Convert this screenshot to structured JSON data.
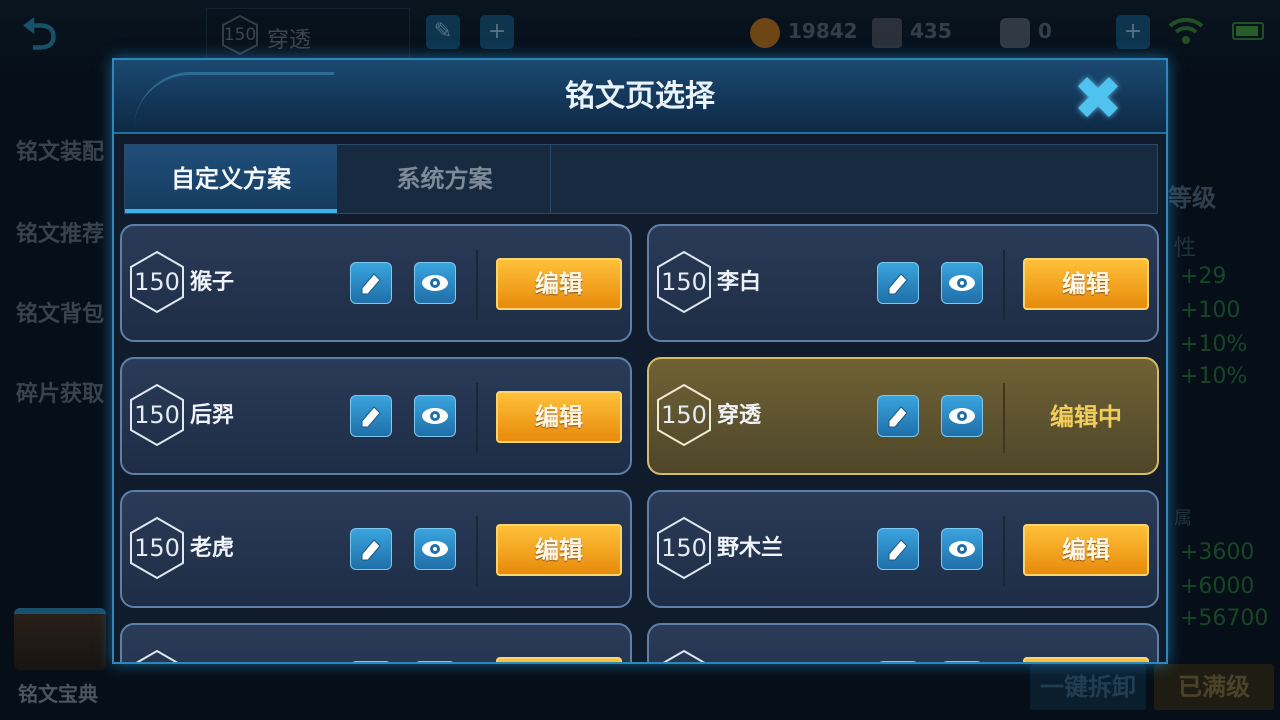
{
  "background": {
    "top_bar": {
      "back_icon": "back-arrow-icon",
      "current_page": {
        "level": "150",
        "name": "穿透"
      },
      "gold": "19842",
      "diamonds": "435",
      "coupons": "0"
    },
    "side_menu": [
      "铭文装配",
      "铭文推荐",
      "铭文背包",
      "碎片获取"
    ],
    "codex_label": "铭文宝典",
    "right_panel": {
      "level_label": "等级",
      "attr_label": "性",
      "attr_values": [
        "+29",
        "+100",
        "+10%",
        "+10%"
      ],
      "bonus_label": "属",
      "bonus_values": [
        "+3600",
        "+6000",
        "+56700"
      ]
    },
    "buttons": {
      "dismantle": "一键拆卸",
      "maxed": "已满级"
    }
  },
  "modal": {
    "title": "铭文页选择",
    "close_icon": "close-x-icon",
    "tabs": [
      {
        "label": "自定义方案",
        "active": true
      },
      {
        "label": "系统方案",
        "active": false
      }
    ],
    "edit_label": "编辑",
    "editing_label": "编辑中",
    "pages": [
      {
        "level": "150",
        "name": "猴子"
      },
      {
        "level": "150",
        "name": "李白"
      },
      {
        "level": "150",
        "name": "后羿"
      },
      {
        "level": "150",
        "name": "穿透",
        "active": true
      },
      {
        "level": "150",
        "name": "老虎"
      },
      {
        "level": "150",
        "name": "野木兰"
      }
    ]
  },
  "colors": {
    "accent_blue": "#2f86b8",
    "edit_button": "#f2a321",
    "active_card": "#6f6236",
    "editing_text": "#f3cd5c"
  }
}
